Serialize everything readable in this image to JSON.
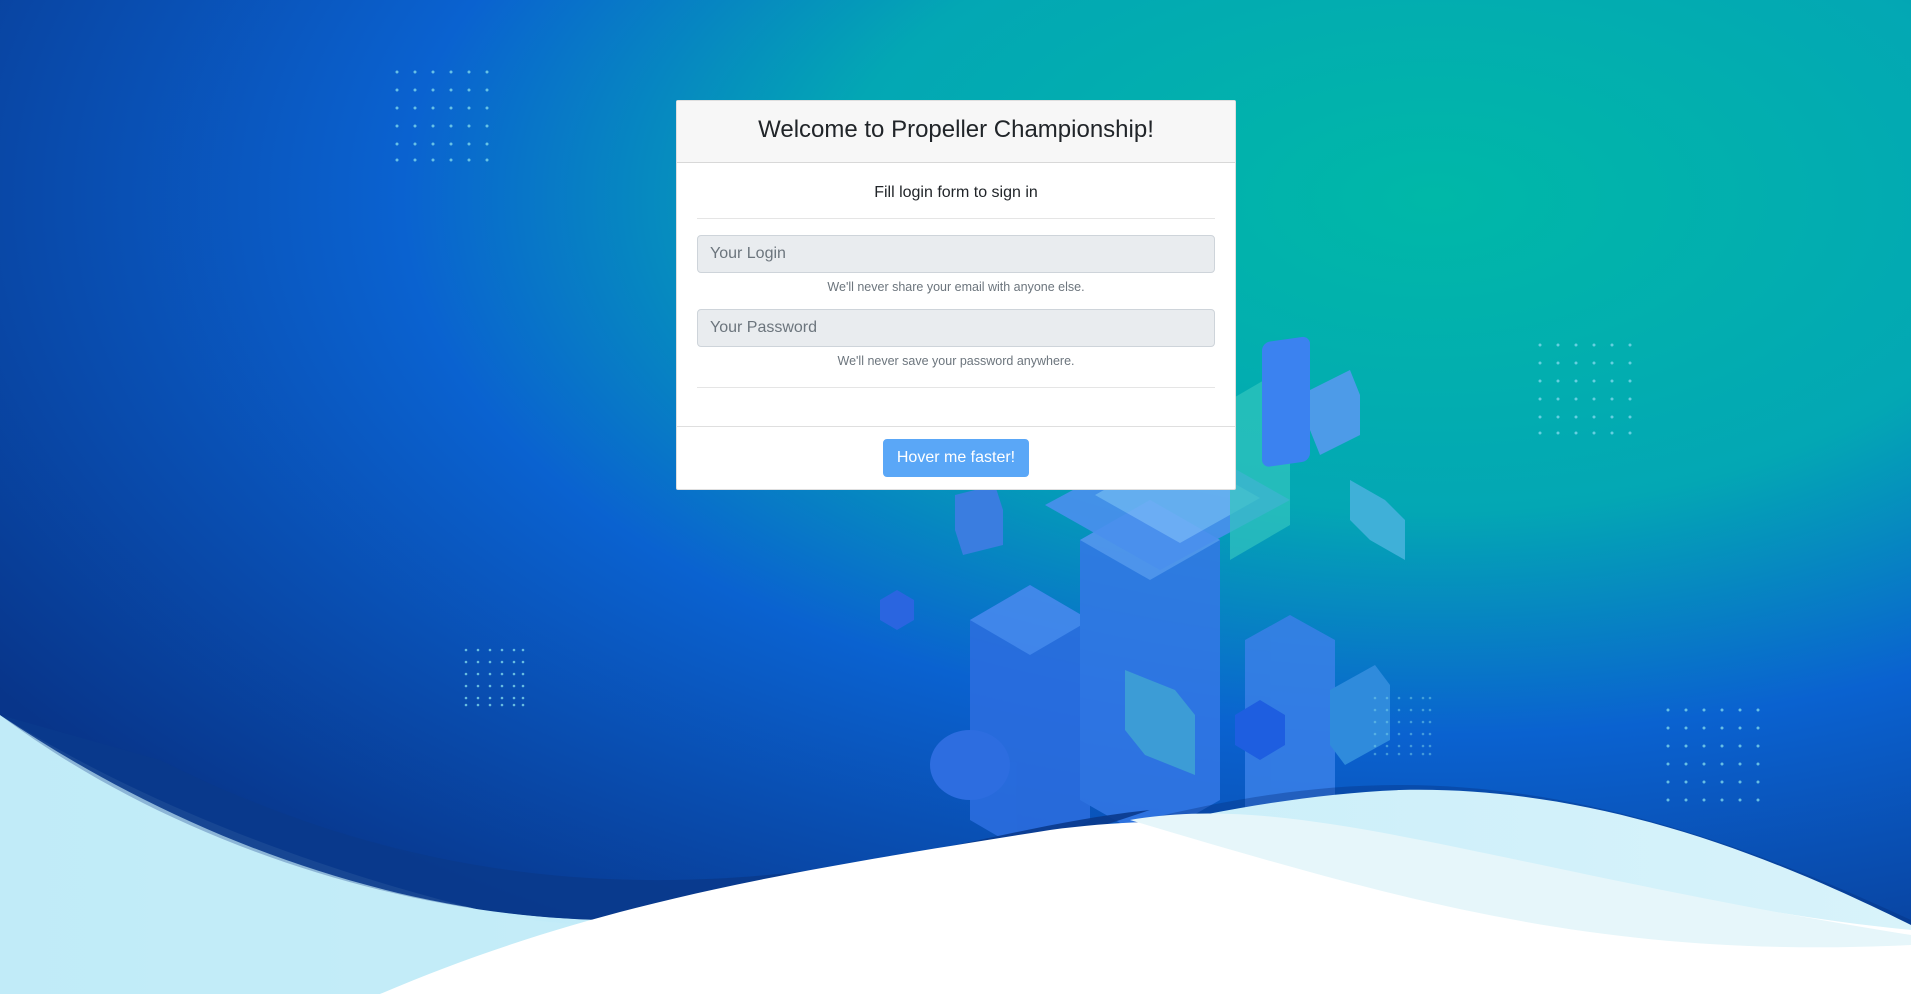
{
  "header": {
    "title": "Welcome to Propeller Championship!"
  },
  "form": {
    "subtitle": "Fill login form to sign in",
    "login": {
      "placeholder": "Your Login",
      "value": "",
      "help": "We'll never share your email with anyone else."
    },
    "password": {
      "placeholder": "Your Password",
      "value": "",
      "help": "We'll never save your password anywhere."
    }
  },
  "footer": {
    "button_label": "Hover me faster!"
  },
  "colors": {
    "button": "#5aa7f7",
    "background_teal": "#00b5a7",
    "background_blue": "#0a3f9e"
  },
  "icons": [
    "trophy-icon",
    "heart-icon",
    "chart-icon",
    "cloud-icon",
    "video-icon",
    "chat-icon",
    "cube-icon",
    "laptop-icon",
    "phone-icon",
    "server-icon"
  ]
}
